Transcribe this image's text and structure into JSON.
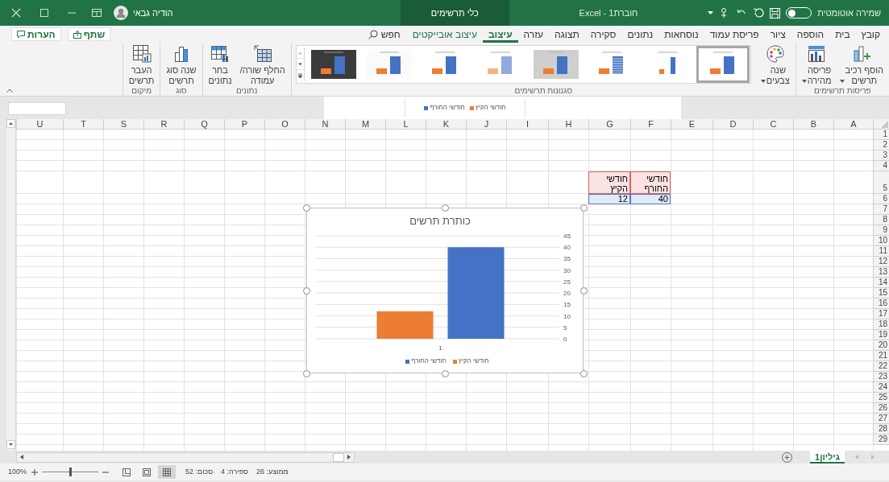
{
  "title_bar": {
    "autosave": {
      "label": "שמירה אוטומטית",
      "on": false
    },
    "title": "חוברת1 - Excel",
    "context_tab": "כלי תרשימים",
    "user": "הודיה גבאי"
  },
  "ribbon_tabs": [
    {
      "label": "קובץ",
      "selected": false,
      "kind": "standard"
    },
    {
      "label": "בית",
      "selected": false,
      "kind": "standard"
    },
    {
      "label": "הוספה",
      "selected": false,
      "kind": "standard"
    },
    {
      "label": "ציור",
      "selected": false,
      "kind": "standard"
    },
    {
      "label": "פריסת עמוד",
      "selected": false,
      "kind": "standard"
    },
    {
      "label": "נוסחאות",
      "selected": false,
      "kind": "standard"
    },
    {
      "label": "נתונים",
      "selected": false,
      "kind": "standard"
    },
    {
      "label": "סקירה",
      "selected": false,
      "kind": "standard"
    },
    {
      "label": "תצוגה",
      "selected": false,
      "kind": "standard"
    },
    {
      "label": "עזרה",
      "selected": false,
      "kind": "standard"
    },
    {
      "label": "עיצוב",
      "selected": true,
      "kind": "standard"
    },
    {
      "label": "עיצוב אובייקטים",
      "selected": false,
      "kind": "contextual"
    }
  ],
  "search": {
    "label": "חפש"
  },
  "share_button": "שתף",
  "comments_button": "הערות",
  "ribbon_groups": [
    {
      "label": "פריסות תרשימים",
      "kind": "buttons",
      "buttons": [
        {
          "label": "הוסף רכיב\nתרשים",
          "dropdown": true
        },
        {
          "label": "פריסה\nמהירה",
          "dropdown": true
        }
      ]
    },
    {
      "label": "סגנונות תרשימים",
      "kind": "gallery",
      "buttons": [
        {
          "label": "שנה\nצבעים",
          "dropdown": true
        }
      ],
      "styles": [
        {
          "kind": "plain",
          "selected": true
        },
        {
          "kind": "labels",
          "selected": false
        },
        {
          "kind": "striped",
          "selected": false
        },
        {
          "kind": "gray",
          "selected": false
        },
        {
          "kind": "faded",
          "selected": false
        },
        {
          "kind": "plain",
          "selected": false
        },
        {
          "kind": "hatched",
          "selected": false
        },
        {
          "kind": "dark",
          "selected": false
        }
      ]
    },
    {
      "label": "נתונים",
      "kind": "buttons",
      "buttons": [
        {
          "label": "החלף שורה/\nעמודה",
          "dropdown": false
        },
        {
          "label": "בחר\nנתונים",
          "dropdown": false
        }
      ]
    },
    {
      "label": "סוג",
      "kind": "buttons",
      "buttons": [
        {
          "label": "שנה סוג\nתרשים",
          "dropdown": false
        }
      ]
    },
    {
      "label": "מיקום",
      "kind": "buttons",
      "buttons": [
        {
          "label": "העבר\nתרשים",
          "dropdown": false
        }
      ]
    }
  ],
  "preview_legend": [
    {
      "label": "חודשי הקיץ",
      "color": "#ed7d31"
    },
    {
      "label": "חודשי החורף",
      "color": "#4472c4"
    }
  ],
  "sheet": {
    "columns": [
      "A",
      "B",
      "C",
      "D",
      "E",
      "F",
      "G",
      "H",
      "I",
      "J",
      "K",
      "L",
      "M",
      "N",
      "O",
      "P",
      "Q",
      "R",
      "S",
      "T",
      "U"
    ],
    "rows": [
      "1",
      "2",
      "3",
      "4",
      "5",
      "6",
      "7",
      "8",
      "9",
      "10",
      "11",
      "12",
      "13",
      "14",
      "15",
      "16",
      "17",
      "18",
      "19",
      "20",
      "21",
      "22",
      "23",
      "24",
      "25",
      "26",
      "27",
      "28",
      "29"
    ],
    "data_range": [
      {
        "header": "חודשי החורף",
        "value": "40"
      },
      {
        "header": "חודשי הקיץ",
        "value": "12"
      }
    ]
  },
  "chart": {
    "chart_data": {
      "type": "bar",
      "title": "כותרת תרשים",
      "categories": [
        "1"
      ],
      "series": [
        {
          "name": "חודשי הקיץ",
          "color": "#ed7d31",
          "values": [
            12
          ]
        },
        {
          "name": "חודשי החורף",
          "color": "#4472c4",
          "values": [
            40
          ]
        }
      ],
      "ylim": [
        0,
        45
      ],
      "yticks": [
        {
          "value": 0,
          "label": "0"
        },
        {
          "value": 5,
          "label": "5"
        },
        {
          "value": 10,
          "label": "10"
        },
        {
          "value": 15,
          "label": "15"
        },
        {
          "value": 20,
          "label": "20"
        },
        {
          "value": 25,
          "label": "25"
        },
        {
          "value": 30,
          "label": "30"
        },
        {
          "value": 35,
          "label": "35"
        },
        {
          "value": 40,
          "label": "40"
        },
        {
          "value": 45,
          "label": "45"
        }
      ],
      "grid": true,
      "legend": true
    }
  },
  "sheet_tabs": [
    {
      "label": "גיליון1",
      "selected": true
    }
  ],
  "status_bar": {
    "stats": [
      "ממוצע: 26",
      "ספירה: 4",
      "סכום: 52"
    ],
    "views": [
      {
        "selected": true
      },
      {
        "selected": false
      },
      {
        "selected": false
      }
    ],
    "zoom_slider": {
      "level": 0.5
    },
    "zoom": "100%"
  }
}
